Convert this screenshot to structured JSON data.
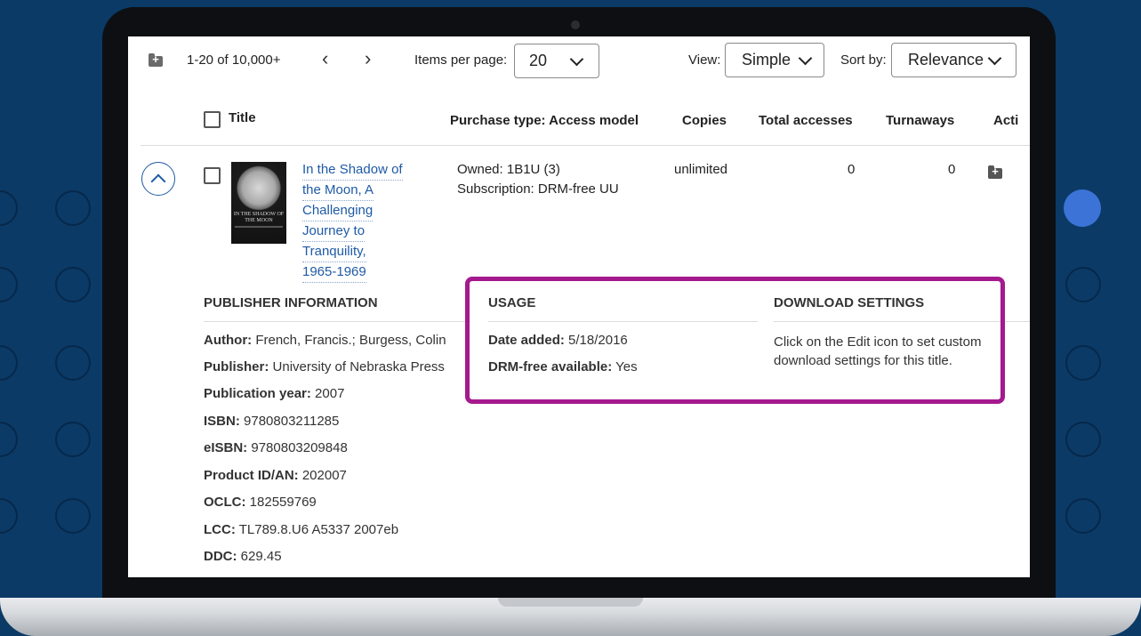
{
  "toolbar": {
    "range_label": "1-20 of 10,000+",
    "items_per_page_label": "Items per page:",
    "items_per_page_value": "20",
    "view_label": "View:",
    "view_value": "Simple",
    "sort_label": "Sort by:",
    "sort_value": "Relevance"
  },
  "columns": {
    "title": "Title",
    "purchase_type": "Purchase type: Access model",
    "copies": "Copies",
    "total_accesses": "Total accesses",
    "turnaways": "Turnaways",
    "actions": "Acti"
  },
  "record": {
    "title_lines": [
      "In the Shadow of",
      "the Moon, A",
      "Challenging",
      "Journey to",
      "Tranquility,",
      "1965-1969"
    ],
    "cover_text": "IN THE SHADOW OF THE MOON",
    "purchase_lines": [
      "Owned: 1B1U (3)",
      "Subscription: DRM-free UU"
    ],
    "copies": "unlimited",
    "total_accesses": "0",
    "turnaways": "0"
  },
  "publisher_info": {
    "heading": "PUBLISHER INFORMATION",
    "fields": [
      {
        "label": "Author:",
        "value": " French, Francis.; Burgess, Colin"
      },
      {
        "label": "Publisher:",
        "value": " University of Nebraska Press"
      },
      {
        "label": "Publication year:",
        "value": " 2007"
      },
      {
        "label": "ISBN:",
        "value": " 9780803211285"
      },
      {
        "label": "eISBN:",
        "value": " 9780803209848"
      },
      {
        "label": "Product ID/AN:",
        "value": " 202007"
      },
      {
        "label": "OCLC:",
        "value": " 182559769"
      },
      {
        "label": "LCC:",
        "value": " TL789.8.U6 A5337 2007eb"
      },
      {
        "label": "DDC:",
        "value": " 629.45"
      }
    ]
  },
  "usage": {
    "heading": "USAGE",
    "fields": [
      {
        "label": "Date added:",
        "value": " 5/18/2016"
      },
      {
        "label": "DRM-free available:",
        "value": " Yes"
      }
    ]
  },
  "download_settings": {
    "heading": "DOWNLOAD SETTINGS",
    "lines": [
      "Click on the Edit icon to set custom",
      "download settings for this title."
    ]
  },
  "colors": {
    "accent_link": "#1f5aa6",
    "highlight": "#a5198e",
    "background": "#0b3a66"
  }
}
